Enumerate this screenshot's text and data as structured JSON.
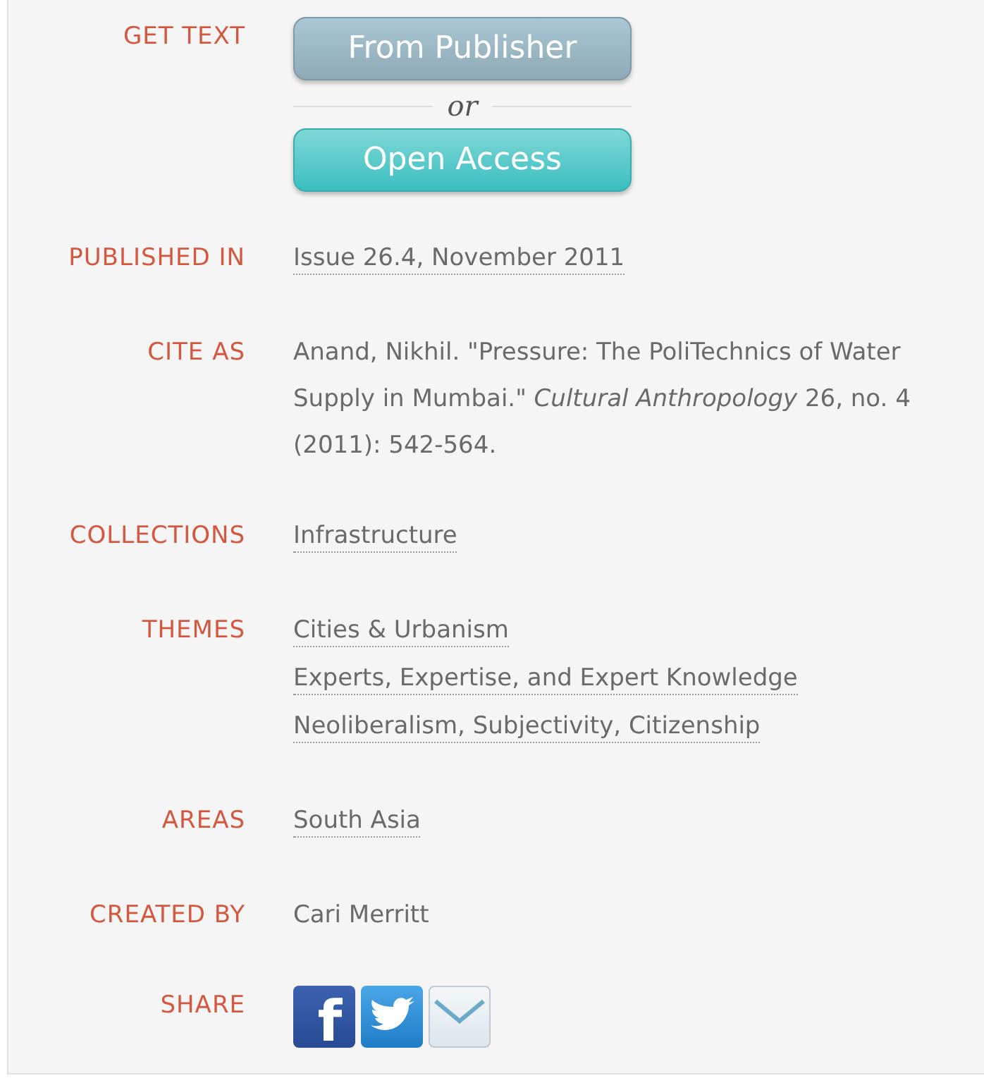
{
  "rows": [
    {
      "label": "GET TEXT",
      "kind": "buttons",
      "buttons": [
        {
          "label": "From Publisher",
          "kind": "publisher"
        },
        {
          "label": "Open Access",
          "kind": "open"
        }
      ],
      "separator": "or"
    },
    {
      "label": "PUBLISHED IN",
      "kind": "links",
      "links": [
        "Issue 26.4, November 2011"
      ]
    },
    {
      "label": "CITE AS",
      "kind": "text",
      "text": "Anand, Nikhil. \"Pressure: The PoliTechnics of Water Supply in Mumbai.\" *Cultural Anthropology* 26, no. 4 (2011): 542-564."
    },
    {
      "label": "COLLECTIONS",
      "kind": "links",
      "links": [
        "Infrastructure"
      ]
    },
    {
      "label": "THEMES",
      "kind": "links",
      "links": [
        "Cities & Urbanism",
        "Experts, Expertise, and Expert Knowledge",
        "Neoliberalism, Subjectivity, Citizenship"
      ]
    },
    {
      "label": "AREAS",
      "kind": "links",
      "links": [
        "South Asia"
      ]
    },
    {
      "label": "CREATED BY",
      "kind": "text",
      "text": "Cari Merritt"
    },
    {
      "label": "SHARE",
      "kind": "share",
      "icons": [
        {
          "kind": "facebook",
          "glyph": "f"
        },
        {
          "kind": "twitter"
        },
        {
          "kind": "email"
        }
      ]
    }
  ]
}
